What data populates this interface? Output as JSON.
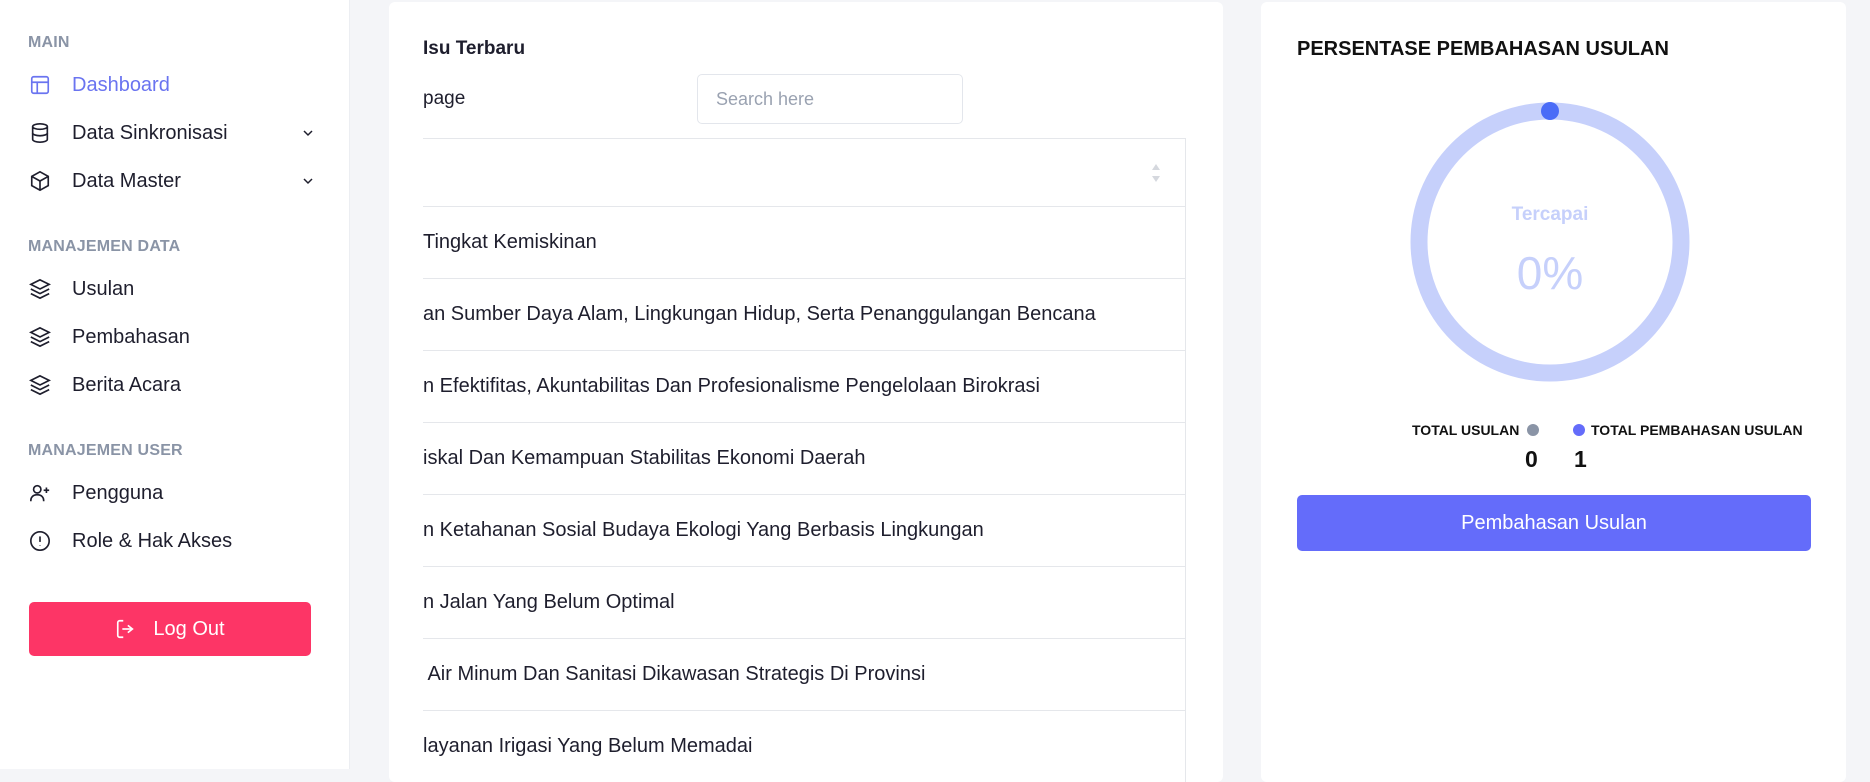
{
  "sidebar": {
    "sections": [
      {
        "title": "MAIN"
      },
      {
        "title": "MANAJEMEN DATA"
      },
      {
        "title": "MANAJEMEN USER"
      }
    ],
    "items": [
      {
        "label": "Dashboard",
        "icon": "layout-icon"
      },
      {
        "label": "Data Sinkronisasi",
        "icon": "database-icon"
      },
      {
        "label": "Data Master",
        "icon": "box-icon"
      },
      {
        "label": "Usulan",
        "icon": "layers-icon"
      },
      {
        "label": "Pembahasan",
        "icon": "layers-icon"
      },
      {
        "label": "Berita Acara",
        "icon": "layers-icon"
      },
      {
        "label": "Pengguna",
        "icon": "user-plus-icon"
      },
      {
        "label": "Role & Hak Akses",
        "icon": "alert-circle-icon"
      }
    ],
    "logout_label": "Log Out"
  },
  "issues": {
    "title": "Isu Terbaru",
    "page_label": "page",
    "search_placeholder": "Search here",
    "rows": [
      "Tingkat Kemiskinan",
      "an Sumber Daya Alam, Lingkungan Hidup, Serta Penanggulangan Bencana",
      "n Efektifitas, Akuntabilitas Dan Profesionalisme Pengelolaan Birokrasi",
      "iskal Dan Kemampuan Stabilitas Ekonomi Daerah",
      "n Ketahanan Sosial Budaya Ekologi Yang Berbasis Lingkungan",
      "n Jalan Yang Belum Optimal",
      " Air Minum Dan Sanitasi Dikawasan Strategis Di Provinsi",
      "layanan Irigasi Yang Belum Memadai"
    ]
  },
  "summary": {
    "title": "PERSENTASE PEMBAHASAN USULAN",
    "gauge_label": "Tercapai",
    "gauge_value": "0%",
    "legend": [
      {
        "label": "TOTAL USULAN",
        "value": "0",
        "color": "#8a94a6"
      },
      {
        "label": "TOTAL PEMBAHASAN USULAN",
        "value": "1",
        "color": "#646cfa"
      }
    ],
    "button_label": "Pembahasan Usulan"
  },
  "colors": {
    "accent": "#646cfa",
    "danger": "#fd3566",
    "gauge_track": "#c6d0fb",
    "gauge_marker": "#4a6cf7"
  }
}
